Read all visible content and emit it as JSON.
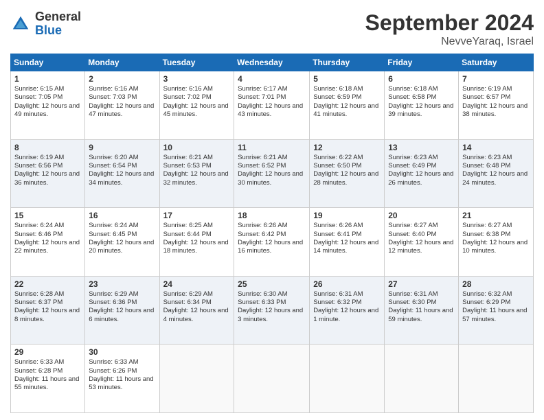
{
  "logo": {
    "general": "General",
    "blue": "Blue"
  },
  "header": {
    "month": "September 2024",
    "location": "NevveYaraq, Israel"
  },
  "weekdays": [
    "Sunday",
    "Monday",
    "Tuesday",
    "Wednesday",
    "Thursday",
    "Friday",
    "Saturday"
  ],
  "weeks": [
    [
      {
        "day": "1",
        "sunrise": "6:15 AM",
        "sunset": "7:05 PM",
        "daylight": "12 hours and 49 minutes."
      },
      {
        "day": "2",
        "sunrise": "6:16 AM",
        "sunset": "7:03 PM",
        "daylight": "12 hours and 47 minutes."
      },
      {
        "day": "3",
        "sunrise": "6:16 AM",
        "sunset": "7:02 PM",
        "daylight": "12 hours and 45 minutes."
      },
      {
        "day": "4",
        "sunrise": "6:17 AM",
        "sunset": "7:01 PM",
        "daylight": "12 hours and 43 minutes."
      },
      {
        "day": "5",
        "sunrise": "6:18 AM",
        "sunset": "6:59 PM",
        "daylight": "12 hours and 41 minutes."
      },
      {
        "day": "6",
        "sunrise": "6:18 AM",
        "sunset": "6:58 PM",
        "daylight": "12 hours and 39 minutes."
      },
      {
        "day": "7",
        "sunrise": "6:19 AM",
        "sunset": "6:57 PM",
        "daylight": "12 hours and 38 minutes."
      }
    ],
    [
      {
        "day": "8",
        "sunrise": "6:19 AM",
        "sunset": "6:56 PM",
        "daylight": "12 hours and 36 minutes."
      },
      {
        "day": "9",
        "sunrise": "6:20 AM",
        "sunset": "6:54 PM",
        "daylight": "12 hours and 34 minutes."
      },
      {
        "day": "10",
        "sunrise": "6:21 AM",
        "sunset": "6:53 PM",
        "daylight": "12 hours and 32 minutes."
      },
      {
        "day": "11",
        "sunrise": "6:21 AM",
        "sunset": "6:52 PM",
        "daylight": "12 hours and 30 minutes."
      },
      {
        "day": "12",
        "sunrise": "6:22 AM",
        "sunset": "6:50 PM",
        "daylight": "12 hours and 28 minutes."
      },
      {
        "day": "13",
        "sunrise": "6:23 AM",
        "sunset": "6:49 PM",
        "daylight": "12 hours and 26 minutes."
      },
      {
        "day": "14",
        "sunrise": "6:23 AM",
        "sunset": "6:48 PM",
        "daylight": "12 hours and 24 minutes."
      }
    ],
    [
      {
        "day": "15",
        "sunrise": "6:24 AM",
        "sunset": "6:46 PM",
        "daylight": "12 hours and 22 minutes."
      },
      {
        "day": "16",
        "sunrise": "6:24 AM",
        "sunset": "6:45 PM",
        "daylight": "12 hours and 20 minutes."
      },
      {
        "day": "17",
        "sunrise": "6:25 AM",
        "sunset": "6:44 PM",
        "daylight": "12 hours and 18 minutes."
      },
      {
        "day": "18",
        "sunrise": "6:26 AM",
        "sunset": "6:42 PM",
        "daylight": "12 hours and 16 minutes."
      },
      {
        "day": "19",
        "sunrise": "6:26 AM",
        "sunset": "6:41 PM",
        "daylight": "12 hours and 14 minutes."
      },
      {
        "day": "20",
        "sunrise": "6:27 AM",
        "sunset": "6:40 PM",
        "daylight": "12 hours and 12 minutes."
      },
      {
        "day": "21",
        "sunrise": "6:27 AM",
        "sunset": "6:38 PM",
        "daylight": "12 hours and 10 minutes."
      }
    ],
    [
      {
        "day": "22",
        "sunrise": "6:28 AM",
        "sunset": "6:37 PM",
        "daylight": "12 hours and 8 minutes."
      },
      {
        "day": "23",
        "sunrise": "6:29 AM",
        "sunset": "6:36 PM",
        "daylight": "12 hours and 6 minutes."
      },
      {
        "day": "24",
        "sunrise": "6:29 AM",
        "sunset": "6:34 PM",
        "daylight": "12 hours and 4 minutes."
      },
      {
        "day": "25",
        "sunrise": "6:30 AM",
        "sunset": "6:33 PM",
        "daylight": "12 hours and 3 minutes."
      },
      {
        "day": "26",
        "sunrise": "6:31 AM",
        "sunset": "6:32 PM",
        "daylight": "12 hours and 1 minute."
      },
      {
        "day": "27",
        "sunrise": "6:31 AM",
        "sunset": "6:30 PM",
        "daylight": "11 hours and 59 minutes."
      },
      {
        "day": "28",
        "sunrise": "6:32 AM",
        "sunset": "6:29 PM",
        "daylight": "11 hours and 57 minutes."
      }
    ],
    [
      {
        "day": "29",
        "sunrise": "6:33 AM",
        "sunset": "6:28 PM",
        "daylight": "11 hours and 55 minutes."
      },
      {
        "day": "30",
        "sunrise": "6:33 AM",
        "sunset": "6:26 PM",
        "daylight": "11 hours and 53 minutes."
      },
      null,
      null,
      null,
      null,
      null
    ]
  ]
}
